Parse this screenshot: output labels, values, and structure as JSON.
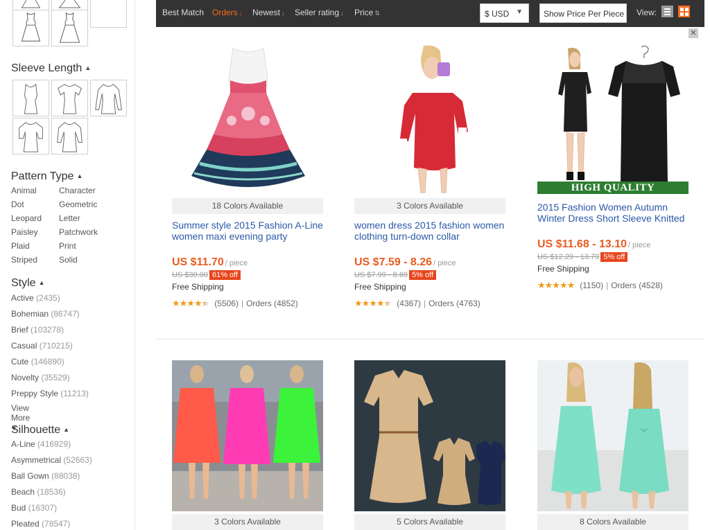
{
  "toolbar": {
    "sort": [
      {
        "label": "Best Match",
        "arrow": ""
      },
      {
        "label": "Orders",
        "arrow": "↓"
      },
      {
        "label": "Newest",
        "arrow": "↓"
      },
      {
        "label": "Seller rating",
        "arrow": "↓"
      },
      {
        "label": "Price",
        "arrow": "⇅"
      }
    ],
    "currency": "$ USD",
    "currency_dd": "▼",
    "show_price_per_piece": "Show Price Per Piece",
    "view_label": "View:"
  },
  "close_label": "✕",
  "sidebar": {
    "sleeve_title": "Sleeve Length",
    "pattern_title": "Pattern Type",
    "pattern_items": [
      "Animal",
      "Character",
      "Dot",
      "Geometric",
      "Leopard",
      "Letter",
      "Paisley",
      "Patchwork",
      "Plaid",
      "Print",
      "Striped",
      "Solid"
    ],
    "style_title": "Style",
    "style_items": [
      {
        "label": "Active",
        "count": "(2435)"
      },
      {
        "label": "Bohemian",
        "count": "(86747)"
      },
      {
        "label": "Brief",
        "count": "(103278)"
      },
      {
        "label": "Casual",
        "count": "(710215)"
      },
      {
        "label": "Cute",
        "count": "(146890)"
      },
      {
        "label": "Novelty",
        "count": "(35529)"
      },
      {
        "label": "Preppy Style",
        "count": "(11213)"
      }
    ],
    "view_more": "View More",
    "silhouette_title": "Silhouette",
    "silhouette_items": [
      {
        "label": "A-Line",
        "count": "(416929)"
      },
      {
        "label": "Asymmetrical",
        "count": "(52663)"
      },
      {
        "label": "Ball Gown",
        "count": "(88038)"
      },
      {
        "label": "Beach",
        "count": "(18536)"
      },
      {
        "label": "Bud",
        "count": "(16307)"
      },
      {
        "label": "Pleated",
        "count": "(78547)"
      }
    ]
  },
  "products": [
    {
      "colors": "18 Colors Available",
      "title": "Summer style 2015 Fashion A-Line women maxi evening party",
      "price": "US $11.70",
      "unit": "/ piece",
      "old_price": "US $30.00",
      "discount": "61% off",
      "shipping": "Free Shipping",
      "stars": "★★★★★",
      "rating": 4.5,
      "reviews": "(5506)",
      "orders": "Orders (4852)"
    },
    {
      "colors": "3 Colors Available",
      "title": "women dress 2015 fashion women clothing turn-down collar",
      "price": "US $7.59 - 8.26",
      "unit": "/ piece",
      "old_price": "US $7.99 - 8.69",
      "discount": "5% off",
      "shipping": "Free Shipping",
      "stars": "★★★★★",
      "rating": 4.5,
      "reviews": "(4367)",
      "orders": "Orders (4763)"
    },
    {
      "colors": "",
      "badge": "HIGH QUALITY",
      "title": "2015 Fashion Women Autumn Winter Dress Short Sleeve Knitted",
      "price": "US $11.68 - 13.10",
      "unit": "/ piece",
      "old_price": "US $12.29 - 13.79",
      "discount": "5% off",
      "shipping": "Free Shipping",
      "stars": "★★★★★",
      "rating": 5,
      "reviews": "(1150)",
      "orders": "Orders (4528)"
    },
    {
      "colors": "3 Colors Available"
    },
    {
      "colors": "5 Colors Available"
    },
    {
      "colors": "8 Colors Available"
    }
  ],
  "separator": "|"
}
